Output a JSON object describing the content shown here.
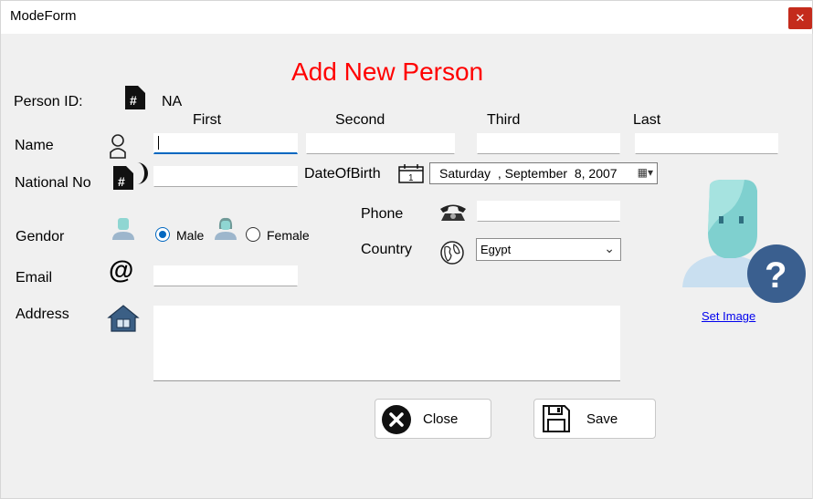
{
  "window": {
    "title": "ModeForm",
    "close_glyph": "✕"
  },
  "heading": "Add New Person",
  "person_id": {
    "label": "Person ID:",
    "value": "NA",
    "icon": "hash-document-icon"
  },
  "name": {
    "label": "Name",
    "columns": [
      "First",
      "Second",
      "Third",
      "Last"
    ],
    "values": [
      "",
      "",
      "",
      ""
    ]
  },
  "national_no": {
    "label": "National No",
    "value": ""
  },
  "date_of_birth": {
    "label": "DateOfBirth",
    "day": "Saturday",
    "date": "  , September  8, 2007"
  },
  "gender": {
    "label": "Gendor",
    "options": [
      "Male",
      "Female"
    ],
    "selected": "Male"
  },
  "phone": {
    "label": "Phone",
    "value": ""
  },
  "country": {
    "label": "Country",
    "value": "Egypt"
  },
  "email": {
    "label": "Email",
    "value": ""
  },
  "address": {
    "label": "Address",
    "value": ""
  },
  "image": {
    "set_label": "Set Image"
  },
  "buttons": {
    "close": "Close",
    "save": "Save"
  },
  "colors": {
    "heading": "#ff0000",
    "accent": "#0067c0",
    "close_button": "#c42b1c"
  }
}
